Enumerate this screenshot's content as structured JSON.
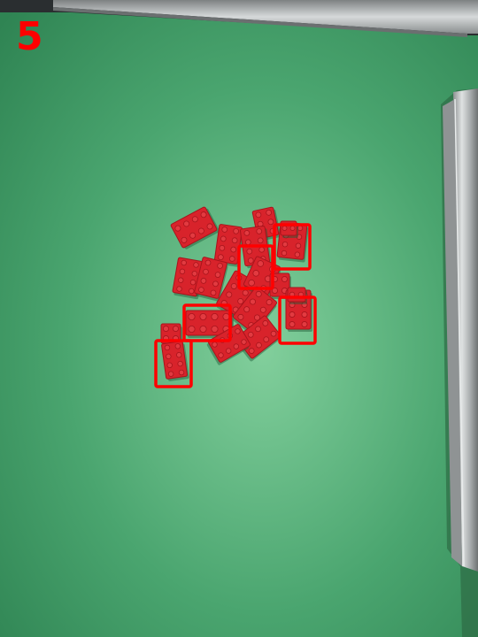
{
  "frame_number": "5",
  "colors": {
    "mat": "#45a06c",
    "mat_light": "#7fd09c",
    "brick": "#d8232b",
    "brick_dark": "#a8141c",
    "highlight": "#ff0000",
    "rail": "#b9bcbd"
  },
  "scene": {
    "brick_count": 19,
    "highlighted_count": 6
  }
}
